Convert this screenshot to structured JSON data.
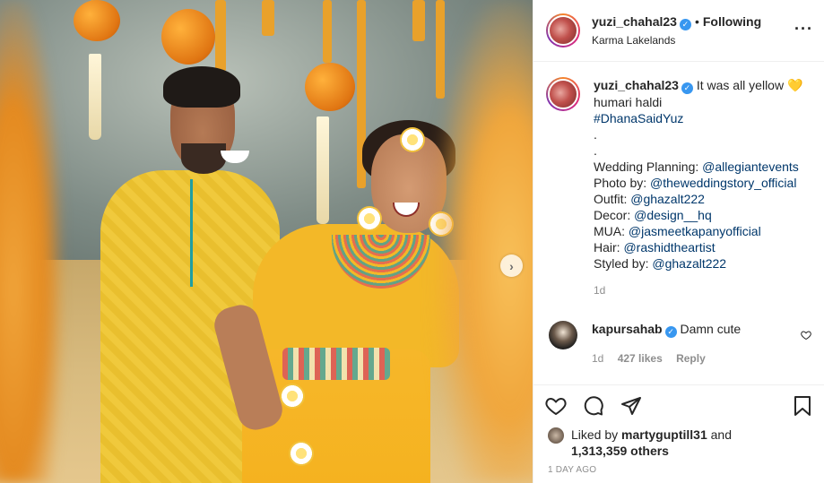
{
  "header": {
    "username": "yuzi_chahal23",
    "separator": "•",
    "follow_status": "Following",
    "location": "Karma Lakelands"
  },
  "caption": {
    "username": "yuzi_chahal23",
    "lines": [
      {
        "prefix": "",
        "text": "It was all yellow"
      },
      {
        "prefix": "",
        "text": "humari haldi"
      },
      {
        "prefix": "",
        "link": "#DhanaSaidYuz"
      },
      {
        "prefix": ".",
        "link": ""
      },
      {
        "prefix": ".",
        "link": ""
      },
      {
        "prefix": "Wedding Planning: ",
        "link": "@allegiantevents"
      },
      {
        "prefix": "Photo by: ",
        "link": "@theweddingstory_official"
      },
      {
        "prefix": "Outfit: ",
        "link": "@ghazalt222"
      },
      {
        "prefix": "Decor: ",
        "link": "@design__hq"
      },
      {
        "prefix": "MUA: ",
        "link": "@jasmeetkapanyofficial"
      },
      {
        "prefix": "Hair: ",
        "link": "@rashidtheartist"
      },
      {
        "prefix": "Styled by: ",
        "link": "@ghazalt222"
      }
    ],
    "timestamp": "1d"
  },
  "comment": {
    "username": "kapursahab",
    "text": "Damn cute",
    "time": "1d",
    "likes": "427 likes",
    "reply": "Reply"
  },
  "likes": {
    "prefix": "Liked by ",
    "user": "martyguptill31",
    "middle": " and",
    "count": "1,313,359 others"
  },
  "posted_ago": "1 DAY AGO",
  "icons": {
    "verified": "✓",
    "heart_emoji": "💛",
    "more": "···",
    "carousel_next": "›"
  },
  "colors": {
    "link": "#00376b",
    "verified": "#3897f0",
    "muted": "#8e8e8e"
  }
}
